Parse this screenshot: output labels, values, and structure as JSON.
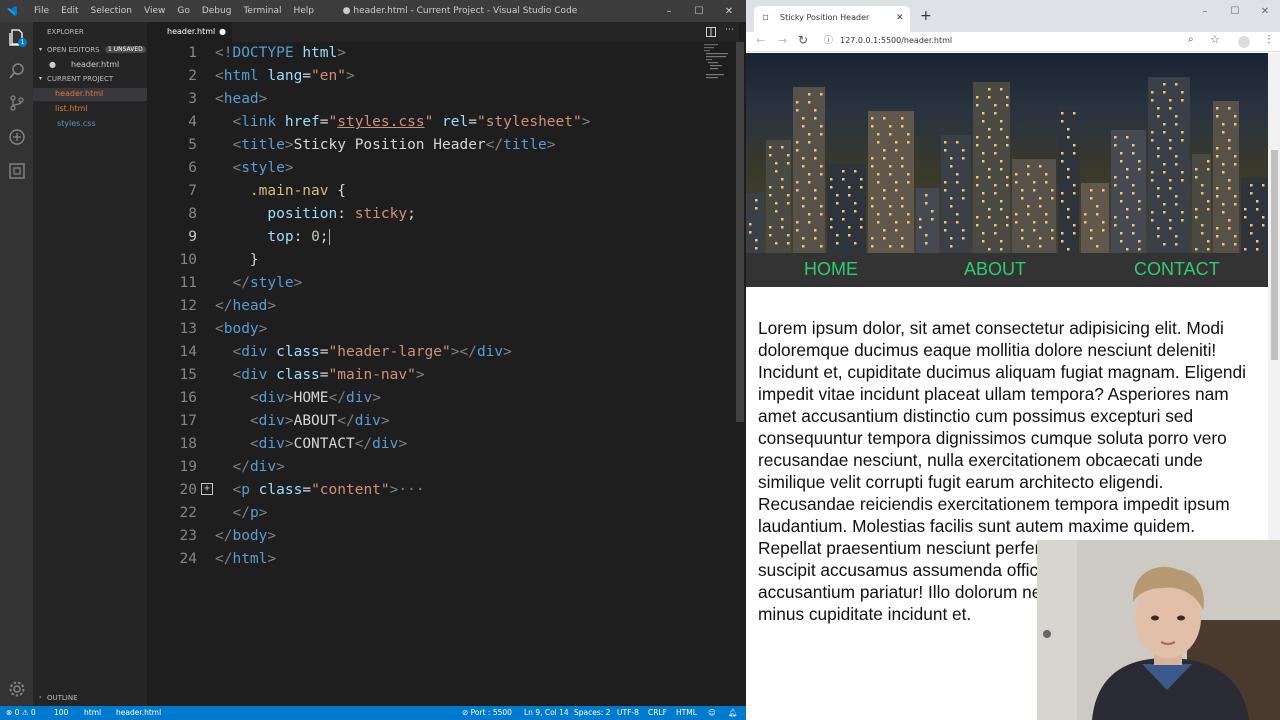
{
  "vscode": {
    "menu": [
      "File",
      "Edit",
      "Selection",
      "View",
      "Go",
      "Debug",
      "Terminal",
      "Help"
    ],
    "window_title": "● header.html - Current Project - Visual Studio Code",
    "sidebar": {
      "explorer": "EXPLORER",
      "open_editors": "OPEN EDITORS",
      "unsaved_badge": "1 UNSAVED",
      "open_file": "header.html",
      "current_project": "CURRENT PROJECT",
      "files": [
        "header.html",
        "list.html",
        "styles.css"
      ],
      "outline": "OUTLINE"
    },
    "tab": {
      "label": "header.html"
    },
    "code_lines": [
      {
        "n": "1"
      },
      {
        "n": "2"
      },
      {
        "n": "3"
      },
      {
        "n": "4"
      },
      {
        "n": "5"
      },
      {
        "n": "6"
      },
      {
        "n": "7"
      },
      {
        "n": "8"
      },
      {
        "n": "9"
      },
      {
        "n": "10"
      },
      {
        "n": "11"
      },
      {
        "n": "12"
      },
      {
        "n": "13"
      },
      {
        "n": "14"
      },
      {
        "n": "15"
      },
      {
        "n": "16"
      },
      {
        "n": "17"
      },
      {
        "n": "18"
      },
      {
        "n": "19"
      },
      {
        "n": "20"
      },
      {
        "n": "22"
      },
      {
        "n": "23"
      },
      {
        "n": "24"
      }
    ],
    "status": {
      "errors": "⊗ 0 ⚠ 0",
      "count": "100",
      "lang1": "html",
      "file": "header.html",
      "port": "⊘ Port : 5500",
      "position": "Ln 9, Col 14",
      "spaces": "Spaces: 2",
      "encoding": "UTF-8",
      "eol": "CRLF",
      "language": "HTML"
    }
  },
  "browser": {
    "tab_title": "Sticky Position Header",
    "url": "127.0.0.1:5500/header.html",
    "nav": [
      "HOME",
      "ABOUT",
      "CONTACT"
    ],
    "content": "Lorem ipsum dolor, sit amet consectetur adipisicing elit. Modi doloremque ducimus eaque mollitia dolore nesciunt deleniti! Incidunt et, cupiditate ducimus aliquam fugiat magnam. Eligendi impedit vitae incidunt placeat ullam tempora? Asperiores nam amet accusantium distinctio cum possimus excepturi sed consequuntur tempora dignissimos cumque soluta porro vero recusandae nesciunt, nulla exercitationem obcaecati unde similique velit corrupti fugit earum architecto eligendi. Recusandae reiciendis exercitationem tempora impedit ipsum laudantium. Molestias facilis sunt autem maxime quidem. Repellat praesentium nesciunt perferendis maxime harum suscipit accusamus assumenda officiis. Cupiditate odit eligendi accusantium pariatur! Illo dolorum nesciunt laborum rerum nulla minus cupiditate incidunt et."
  },
  "colors": {
    "accent": "#007acc",
    "nav_text": "#2ecc71",
    "nav_bg": "#333333"
  }
}
